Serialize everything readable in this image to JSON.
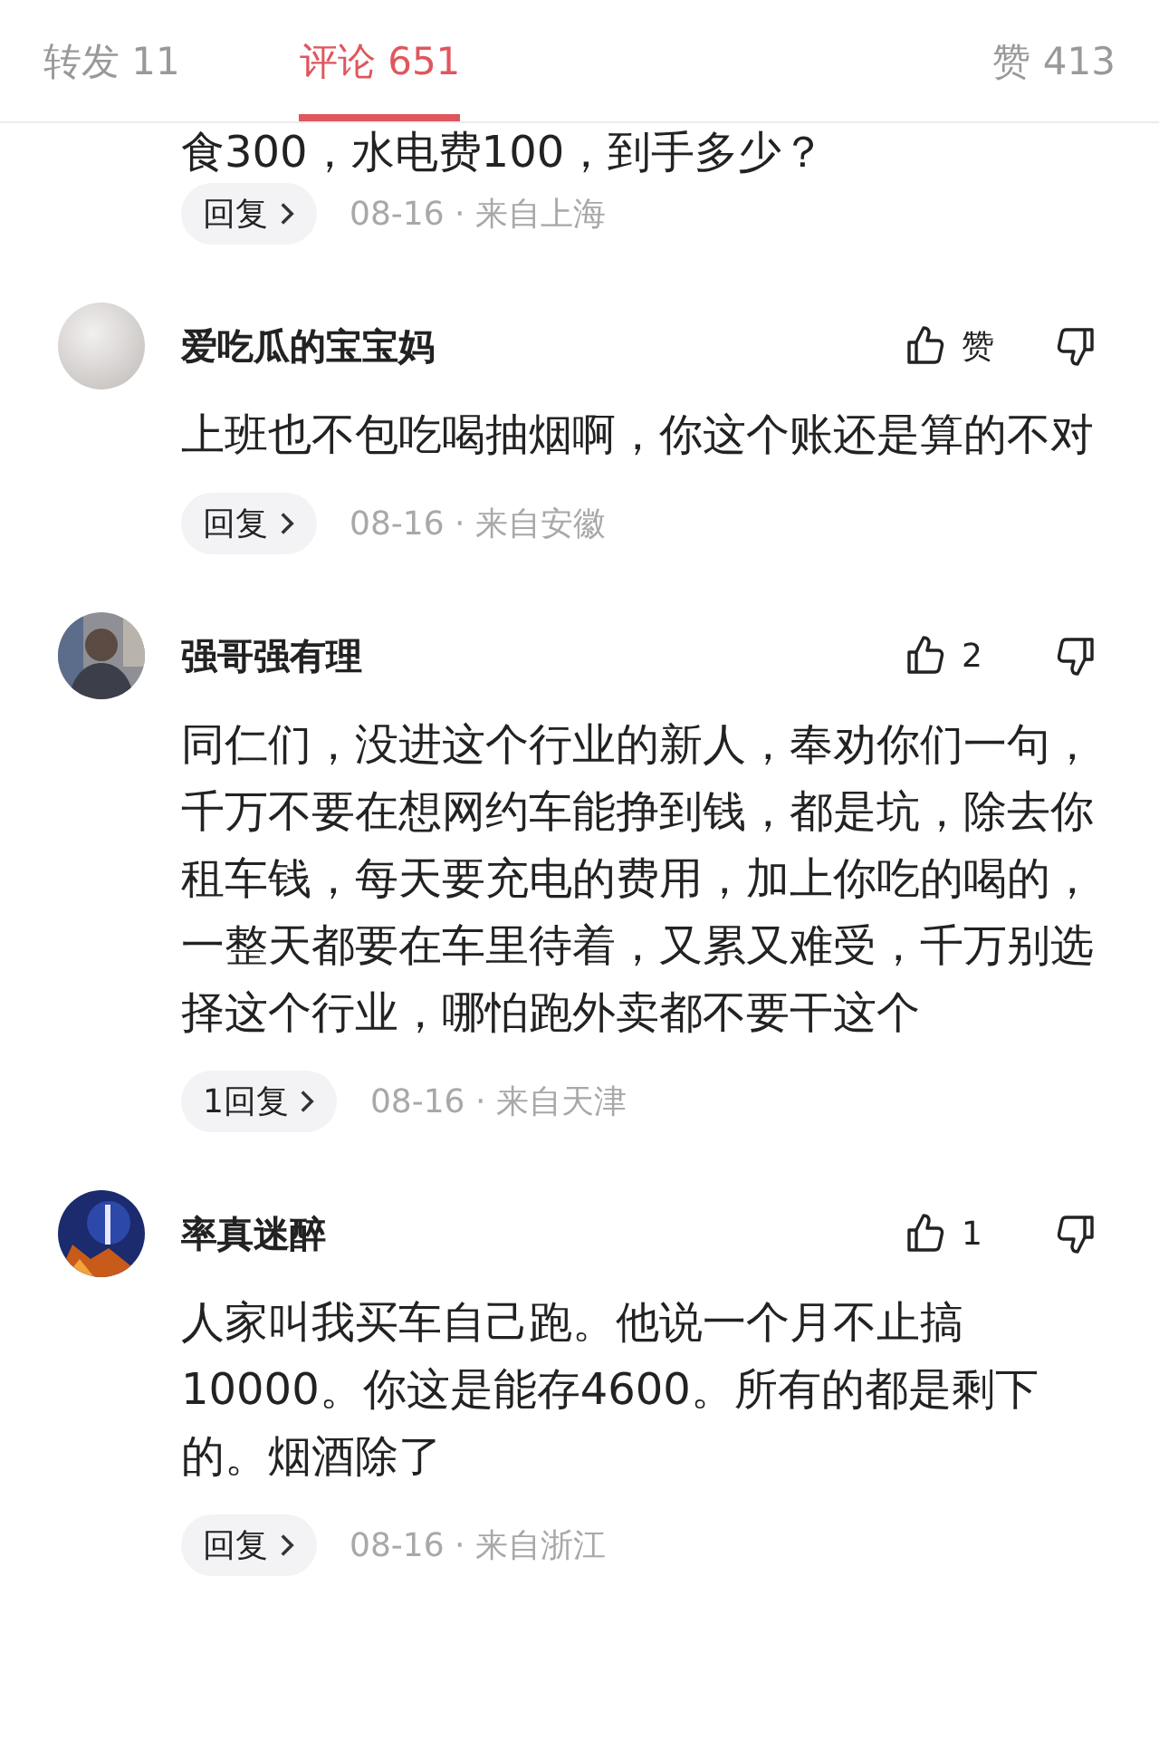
{
  "tabs": [
    {
      "label": "转发 11",
      "selected": false
    },
    {
      "label": "评论 651",
      "selected": true
    },
    {
      "label": "赞 413",
      "selected": false
    }
  ],
  "partial_comment": {
    "text": "食300，水电费100，到手多少？",
    "reply_label": "回复",
    "meta": "08-16 · 来自上海"
  },
  "comments": [
    {
      "name": "爱吃瓜的宝宝妈",
      "likes": "赞",
      "text": "上班也不包吃喝抽烟啊，你这个账还是算的不对",
      "reply_label": "回复",
      "meta": "08-16 · 来自安徽"
    },
    {
      "name": "强哥强有理",
      "likes": "2",
      "text": "同仁们，没进这个行业的新人，奉劝你们一句，千万不要在想网约车能挣到钱，都是坑，除去你租车钱，每天要充电的费用，加上你吃的喝的，一整天都要在车里待着，又累又难受，千万别选择这个行业，哪怕跑外卖都不要干这个",
      "reply_label": "1回复",
      "meta": "08-16 · 来自天津"
    },
    {
      "name": "率真迷醉",
      "likes": "1",
      "text": "人家叫我买车自己跑。他说一个月不止搞10000。你这是能存4600。所有的都是剩下的。烟酒除了",
      "reply_label": "回复",
      "meta": "08-16 · 来自浙江"
    }
  ]
}
